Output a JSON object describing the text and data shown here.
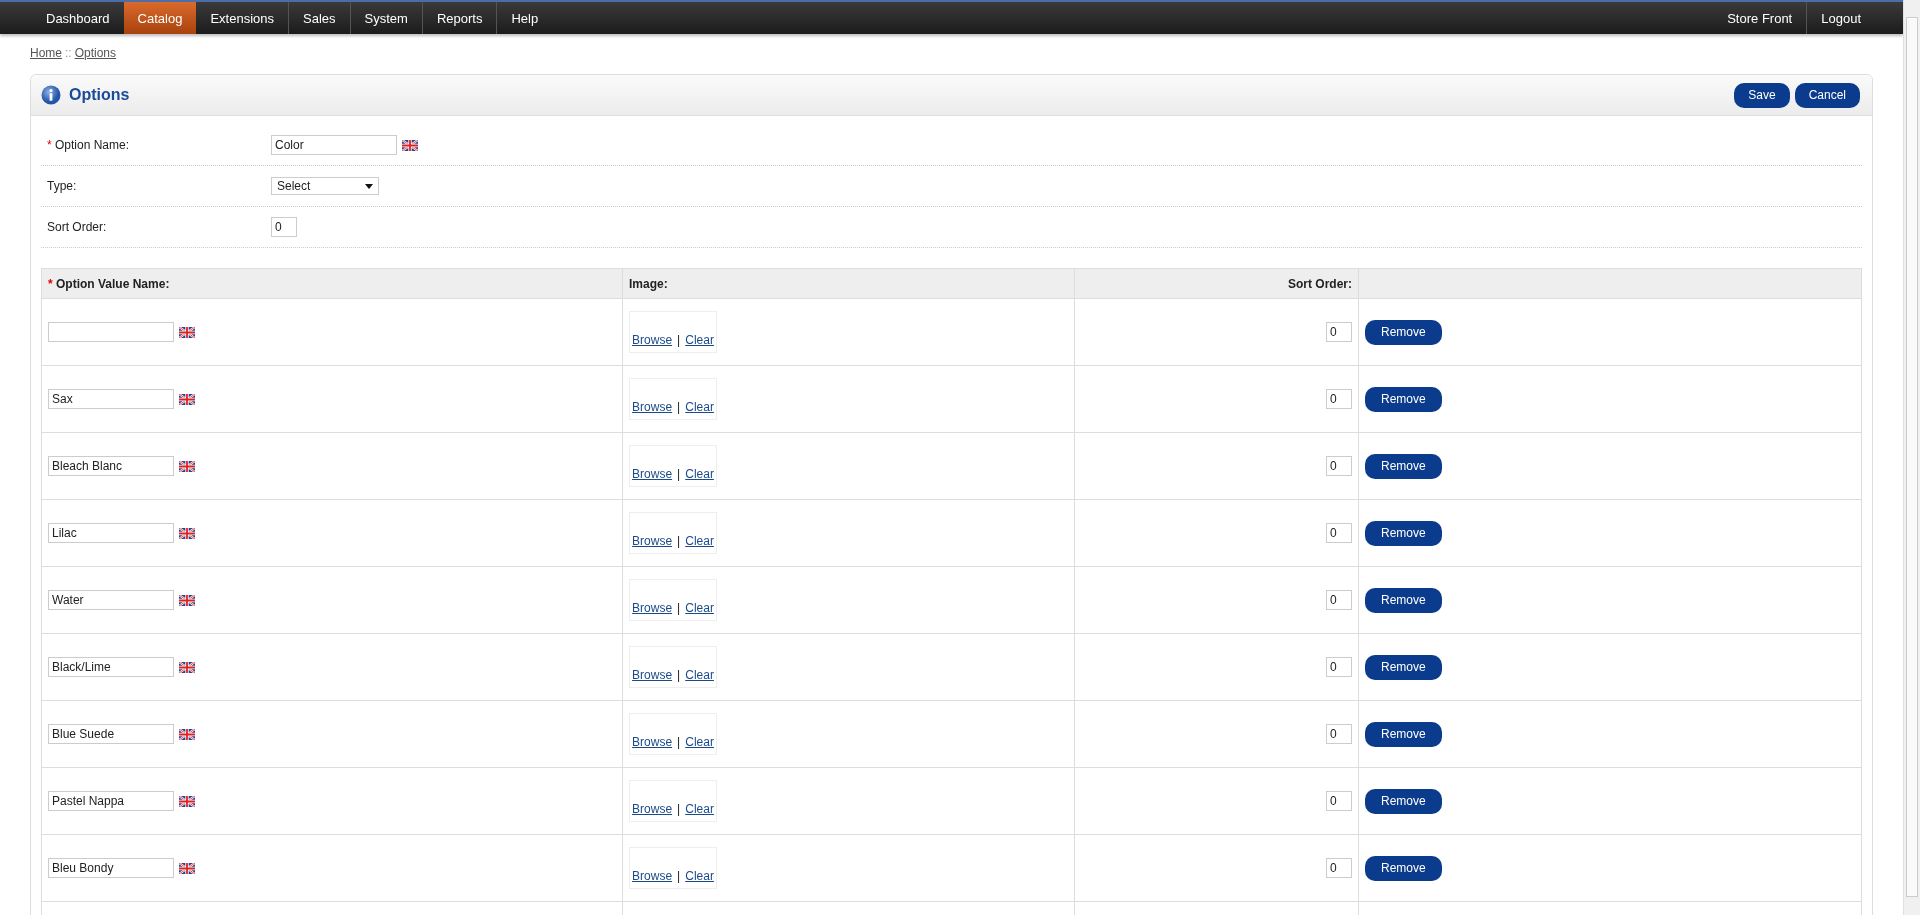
{
  "nav": {
    "items": [
      {
        "label": "Dashboard",
        "selected": false
      },
      {
        "label": "Catalog",
        "selected": true
      },
      {
        "label": "Extensions",
        "selected": false
      },
      {
        "label": "Sales",
        "selected": false
      },
      {
        "label": "System",
        "selected": false
      },
      {
        "label": "Reports",
        "selected": false
      },
      {
        "label": "Help",
        "selected": false
      }
    ],
    "right_items": [
      "Store Front",
      "Logout"
    ]
  },
  "breadcrumb": [
    "Home",
    "Options"
  ],
  "breadcrumb_separator": "::",
  "panel": {
    "title": "Options",
    "buttons": [
      "Save",
      "Cancel"
    ]
  },
  "form": {
    "fields": [
      {
        "label": "Option Name:",
        "required_mark": "*",
        "kind": "text-lang",
        "value": "Color"
      },
      {
        "label": "Type:",
        "kind": "select",
        "value": "Select"
      },
      {
        "label": "Sort Order:",
        "kind": "number",
        "value": "0"
      }
    ]
  },
  "values_table": {
    "columns": [
      {
        "label": "Option Value Name:",
        "required_mark": "*"
      },
      {
        "label": "Image:"
      },
      {
        "label": "Sort Order:"
      }
    ],
    "rows": [
      {
        "name": "",
        "browse": "Browse",
        "separator": "|",
        "clear": "Clear",
        "sort_order": "0",
        "remove": "Remove"
      },
      {
        "name": "Sax",
        "browse": "Browse",
        "separator": "|",
        "clear": "Clear",
        "sort_order": "0",
        "remove": "Remove"
      },
      {
        "name": "Bleach Blanc",
        "browse": "Browse",
        "separator": "|",
        "clear": "Clear",
        "sort_order": "0",
        "remove": "Remove"
      },
      {
        "name": "Lilac",
        "browse": "Browse",
        "separator": "|",
        "clear": "Clear",
        "sort_order": "0",
        "remove": "Remove"
      },
      {
        "name": "Water",
        "browse": "Browse",
        "separator": "|",
        "clear": "Clear",
        "sort_order": "0",
        "remove": "Remove"
      },
      {
        "name": "Black/Lime",
        "browse": "Browse",
        "separator": "|",
        "clear": "Clear",
        "sort_order": "0",
        "remove": "Remove"
      },
      {
        "name": "Blue Suede",
        "browse": "Browse",
        "separator": "|",
        "clear": "Clear",
        "sort_order": "0",
        "remove": "Remove"
      },
      {
        "name": "Pastel Nappa",
        "browse": "Browse",
        "separator": "|",
        "clear": "Clear",
        "sort_order": "0",
        "remove": "Remove"
      },
      {
        "name": "Bleu Bondy",
        "browse": "Browse",
        "separator": "|",
        "clear": "Clear",
        "sort_order": "0",
        "remove": "Remove"
      }
    ]
  }
}
